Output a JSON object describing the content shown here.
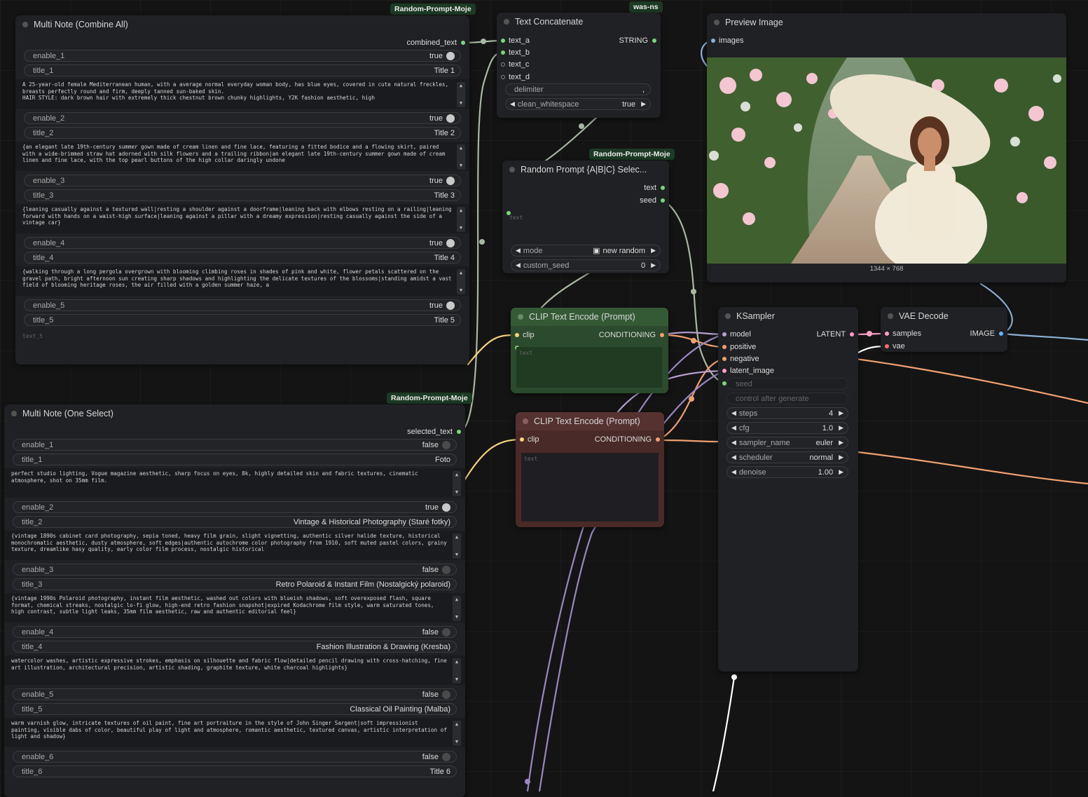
{
  "tags": {
    "rp1": "Random-Prompt-Moje",
    "wasns": "was-ns",
    "rp2": "Random-Prompt-Moje",
    "rp3": "Random-Prompt-Moje"
  },
  "multi_all": {
    "title": "Multi Note (Combine All)",
    "output": "combined_text",
    "rows": [
      {
        "enable": "enable_1",
        "state": "true",
        "title_label": "title_1",
        "title": "Title 1",
        "text": "A 25-year-old female Mediterranean human, with a average normal everyday woman body, has blue eyes, covered in cute natural freckles, breasts perfectly round and firm, deeply tanned sun-baked skin.\nHAIR STYLE: dark brown hair with extremely thick chestnut brown chunky highlights, Y2K fashion aesthetic, high"
      },
      {
        "enable": "enable_2",
        "state": "true",
        "title_label": "title_2",
        "title": "Title 2",
        "text": "{an elegant late 19th-century summer gown made of cream linen and fine lace, featuring a fitted bodice and a flowing skirt, paired with a wide-brimmed straw hat adorned with silk flowers and a trailing ribbon|an elegant late 19th-century summer gown made of cream linen and fine lace, with the top pearl buttons of the high collar daringly undone"
      },
      {
        "enable": "enable_3",
        "state": "true",
        "title_label": "title_3",
        "title": "Title 3",
        "text": "{leaning casually against a textured wall|resting a shoulder against a doorframe|leaning back with elbows resting on a railing|leaning forward with hands on a waist-high surface|leaning against a pillar with a dreamy expression|resting casually against the side of a vintage car}"
      },
      {
        "enable": "enable_4",
        "state": "true",
        "title_label": "title_4",
        "title": "Title 4",
        "text": "{walking through a long pergola overgrown with blooming climbing roses in shades of pink and white, flower petals scattered on the gravel path, bright afternoon sun creating sharp shadows and highlighting the delicate textures of the blossoms|standing amidst a vast field of blooming heritage roses, the air filled with a golden summer haze, a"
      },
      {
        "enable": "enable_5",
        "state": "true",
        "title_label": "title_5",
        "title": "Title 5",
        "text": ""
      }
    ],
    "last_placeholder": "text_5"
  },
  "multi_one": {
    "title": "Multi Note (One Select)",
    "output": "selected_text",
    "rows": [
      {
        "enable": "enable_1",
        "state": "false",
        "title_label": "title_1",
        "title": "Foto",
        "text": "perfect studio lighting, Vogue magazine aesthetic, sharp focus on eyes, 8k, highly detailed skin and fabric textures, cinematic atmosphere, shot on 35mm film."
      },
      {
        "enable": "enable_2",
        "state": "true",
        "title_label": "title_2",
        "title": "Vintage & Historical Photography (Staré fotky)",
        "text": "{vintage 1890s cabinet card photography, sepia toned, heavy film grain, slight vignetting, authentic silver halide texture, historical monochromatic aesthetic, dusty atmosphere, soft edges|authentic autochrome color photography from 1910, soft muted pastel colors, grainy texture, dreamlike hasy quality, early color film process, nostalgic historical"
      },
      {
        "enable": "enable_3",
        "state": "false",
        "title_label": "title_3",
        "title": "Retro Polaroid & Instant Film (Nostalgický polaroid)",
        "text": "{vintage 1990s Polaroid photography, instant film aesthetic, washed out colors with blueish shadows, soft overexposed flash, square format, chemical streaks, nostalgic lo-fi glow, high-end retro fashion snapshot|expired Kodachrome film style, warm saturated tones, high contrast, subtle light leaks, 35mm film aesthetic, raw and authentic editorial feel}"
      },
      {
        "enable": "enable_4",
        "state": "false",
        "title_label": "title_4",
        "title": "Fashion Illustration & Drawing (Kresba)",
        "text": "watercolor washes, artistic expressive strokes, emphasis on silhouette and fabric flow|detailed pencil drawing with cross-hatching, fine art illustration, architectural precision, artistic shading, graphite texture, white charcoal highlights}"
      },
      {
        "enable": "enable_5",
        "state": "false",
        "title_label": "title_5",
        "title": "Classical Oil Painting (Malba)",
        "text": "warm varnish glow, intricate textures of oil paint, fine art portraiture in the style of John Singer Sargent|soft impressionist painting, visible dabs of color, beautiful play of light and atmosphere, romantic aesthetic, textured canvas, artistic interpretation of light and shadow}"
      },
      {
        "enable": "enable_6",
        "state": "false",
        "title_label": "title_6",
        "title": "Title 6",
        "text": ""
      }
    ]
  },
  "concat": {
    "title": "Text Concatenate",
    "inputs": [
      "text_a",
      "text_b",
      "text_c",
      "text_d"
    ],
    "output": "STRING",
    "delimiter_label": "delimiter",
    "delimiter_value": ",",
    "ws_label": "clean_whitespace",
    "ws_value": "true"
  },
  "random": {
    "title": "Random Prompt {A|B|C} Selec...",
    "out_text": "text",
    "out_seed": "seed",
    "placeholder": "text",
    "mode_label": "mode",
    "mode_value": "new random",
    "seed_label": "custom_seed",
    "seed_value": "0"
  },
  "clip_pos": {
    "title": "CLIP Text Encode (Prompt)",
    "input": "clip",
    "output": "CONDITIONING",
    "placeholder": "text"
  },
  "clip_neg": {
    "title": "CLIP Text Encode (Prompt)",
    "input": "clip",
    "output": "CONDITIONING",
    "placeholder": "text"
  },
  "preview": {
    "title": "Preview Image",
    "input": "images",
    "dims": "1344 × 768"
  },
  "ksampler": {
    "title": "KSampler",
    "inputs": [
      "model",
      "positive",
      "negative",
      "latent_image"
    ],
    "output": "LATENT",
    "seed_label": "seed",
    "control_label": "control after generate",
    "widgets": [
      {
        "label": "steps",
        "value": "4"
      },
      {
        "label": "cfg",
        "value": "1.0"
      },
      {
        "label": "sampler_name",
        "value": "euler"
      },
      {
        "label": "scheduler",
        "value": "normal"
      },
      {
        "label": "denoise",
        "value": "1.00"
      }
    ]
  },
  "vae": {
    "title": "VAE Decode",
    "inputs": [
      "samples",
      "vae"
    ],
    "output": "IMAGE"
  },
  "colors": {
    "string_pin": "#7bd67b",
    "clip_pin": "#f4d37c",
    "cond_pin": "#f0a070",
    "latent_pin": "#ff9ec8",
    "image_pin": "#64b5f6",
    "clip_green_bg": "#2c4a2d",
    "clip_red_bg": "#4a2a28"
  }
}
